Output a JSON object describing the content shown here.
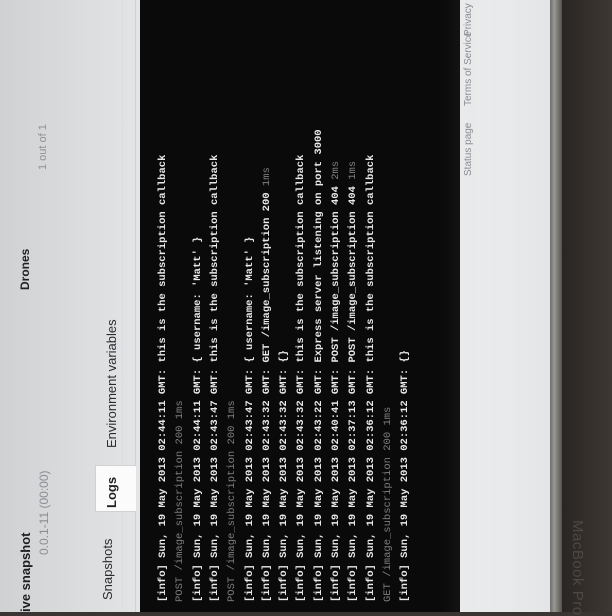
{
  "header": {
    "section_title": "ive snapshot",
    "version": "0.0.1-11 (00:00)",
    "app_name": "Drones",
    "pager": "1 out of 1"
  },
  "tabs": [
    {
      "label": "Snapshots",
      "active": false
    },
    {
      "label": "Logs",
      "active": true
    },
    {
      "label": "Environment variables",
      "active": false
    }
  ],
  "log_lines": [
    {
      "prefix": "[info] Sun, 19 May 2013 02:44:11 GMT: ",
      "text": "this is the subscription callback",
      "status": "",
      "tail": "",
      "dim": false
    },
    {
      "prefix": "POST /image_subscription ",
      "text": "",
      "status": "200",
      "tail": " 1ms",
      "dim": true
    },
    {
      "prefix": "[info] Sun, 19 May 2013 02:44:11 GMT: ",
      "text": "{ username: 'Matt' }",
      "status": "",
      "tail": "",
      "dim": false
    },
    {
      "prefix": "[info] Sun, 19 May 2013 02:43:47 GMT: ",
      "text": "this is the subscription callback",
      "status": "",
      "tail": "",
      "dim": false
    },
    {
      "prefix": "POST /image_subscription ",
      "text": "",
      "status": "200",
      "tail": " 1ms",
      "dim": true
    },
    {
      "prefix": "[info] Sun, 19 May 2013 02:43:47 GMT: ",
      "text": "{ username: 'Matt' }",
      "status": "",
      "tail": "",
      "dim": false
    },
    {
      "prefix": "[info] Sun, 19 May 2013 02:43:32 GMT: ",
      "text": "GET /image_subscription ",
      "status": "200",
      "tail": " 1ms",
      "dim": false
    },
    {
      "prefix": "[info] Sun, 19 May 2013 02:43:32 GMT: ",
      "text": "{}",
      "status": "",
      "tail": "",
      "dim": false
    },
    {
      "prefix": "[info] Sun, 19 May 2013 02:43:32 GMT: ",
      "text": "this is the subscription callback",
      "status": "",
      "tail": "",
      "dim": false
    },
    {
      "prefix": "[info] Sun, 19 May 2013 02:43:22 GMT: ",
      "text": "Express server listening on port 3000",
      "status": "",
      "tail": "",
      "dim": false
    },
    {
      "prefix": "[info] Sun, 19 May 2013 02:40:41 GMT: ",
      "text": "POST /image_subscription ",
      "status": "404",
      "tail": " 2ms",
      "dim": false
    },
    {
      "prefix": "[info] Sun, 19 May 2013 02:37:13 GMT: ",
      "text": "POST /image_subscription ",
      "status": "404",
      "tail": " 1ms",
      "dim": false
    },
    {
      "prefix": "[info] Sun, 19 May 2013 02:36:12 GMT: ",
      "text": "this is the subscription callback",
      "status": "",
      "tail": "",
      "dim": false
    },
    {
      "prefix": "GET /image_subscription ",
      "text": "",
      "status": "200",
      "tail": " 1ms",
      "dim": true
    },
    {
      "prefix": "[info] Sun, 19 May 2013 02:36:12 GMT: ",
      "text": "{}",
      "status": "",
      "tail": "",
      "dim": false
    }
  ],
  "footer": {
    "status_page": "Status page",
    "terms": "Terms of Service",
    "privacy": "Privacy p"
  },
  "device_brand": "MacBook Pro",
  "colors": {
    "terminal_bg": "#0a0a0a",
    "status_ok": "#5fd05a",
    "status_not_found": "#e9dd63"
  }
}
